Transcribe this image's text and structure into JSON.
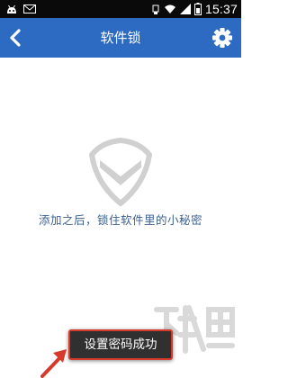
{
  "status_bar": {
    "time": "15:37",
    "icons": [
      "android-icon",
      "mail-icon",
      "usb-icon",
      "wifi-icon",
      "signal-icon",
      "battery-icon"
    ]
  },
  "header": {
    "title": "软件锁",
    "back_icon": "chevron-left-icon",
    "settings_icon": "gear-icon",
    "color": "#2d6bc3"
  },
  "main": {
    "hint": "添加之后，锁住软件里的小秘密",
    "empty_icon": "shield-icon"
  },
  "toast": {
    "text": "设置密码成功",
    "highlight_color": "#d63a2a"
  },
  "watermark": {
    "text": "下载吧"
  }
}
